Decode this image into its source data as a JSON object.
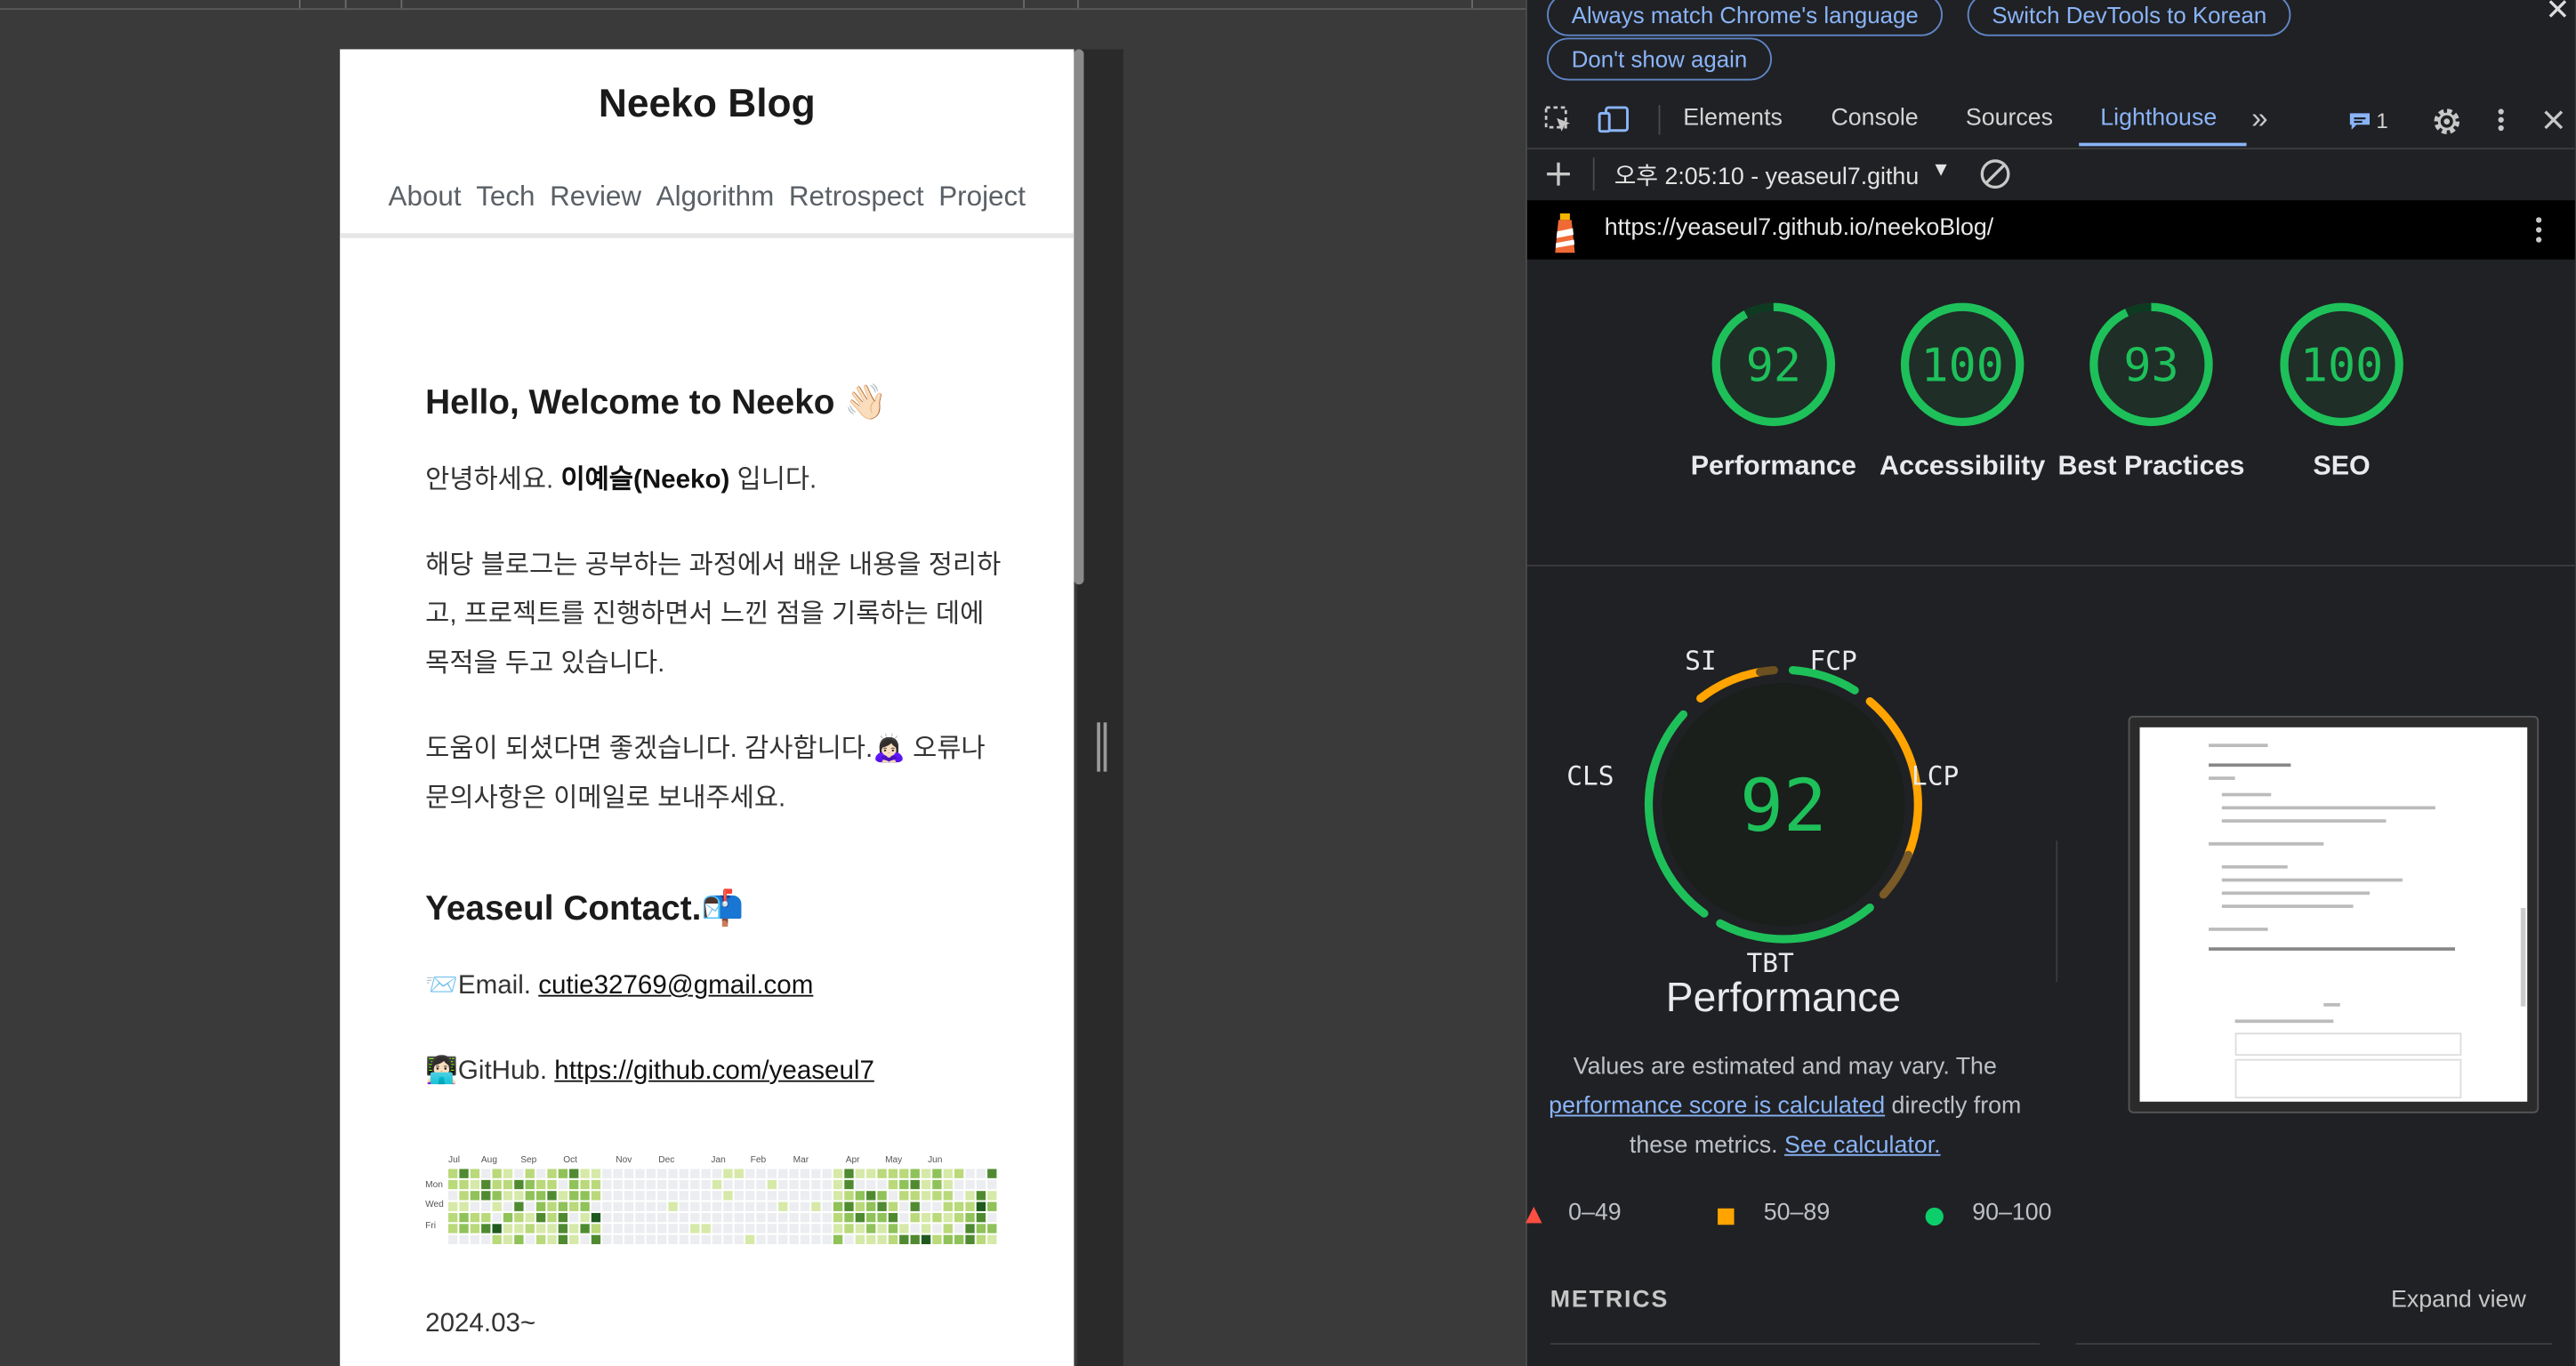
{
  "blog": {
    "title": "Neeko Blog",
    "nav": [
      "About",
      "Tech",
      "Review",
      "Algorithm",
      "Retrospect",
      "Project"
    ],
    "greeting": "Hello, Welcome to Neeko 👋🏻",
    "intro_pre": "안녕하세요. ",
    "intro_name": "이예슬(Neeko)",
    "intro_post": " 입니다.",
    "para2": "해당 블로그는 공부하는 과정에서 배운 내용을 정리하고, 프로젝트를 진행하면서 느낀 점을 기록하는 데에 목적을 두고 있습니다.",
    "para3": "도움이 되셨다면 좋겠습니다. 감사합니다.🙇🏻‍♀️ 오류나 문의사항은 이메일로 보내주세요.",
    "contact_heading": "Yeaseul Contact.📬",
    "email_label": "📨Email. ",
    "email": "cutie32769@gmail.com",
    "github_label": "👩🏻‍💻GitHub. ",
    "github": "https://github.com/yeaseul7",
    "graph_months": [
      "Jul",
      "Aug",
      "Sep",
      "Oct",
      "Nov",
      "Dec",
      "Jan",
      "Feb",
      "Mar",
      "Apr",
      "May",
      "Jun"
    ],
    "graph_days": [
      "Mon",
      "Wed",
      "Fri"
    ],
    "date_line": "2024.03~"
  },
  "devtools": {
    "banner": {
      "match_language": "Always match Chrome's language",
      "switch_korean": "Switch DevTools to Korean",
      "dont_show": "Don't show again"
    },
    "tabs": [
      "Elements",
      "Console",
      "Sources",
      "Lighthouse"
    ],
    "issues_count": "1",
    "report_select": "오후 2:05:10 - yeaseul7.githu",
    "url": "https://yeaseul7.github.io/neekoBlog/",
    "scores": [
      {
        "label": "Performance",
        "value": 92
      },
      {
        "label": "Accessibility",
        "value": 100
      },
      {
        "label": "Best Practices",
        "value": 93
      },
      {
        "label": "SEO",
        "value": 100
      }
    ],
    "perf_gauge": {
      "score": "92",
      "metric_labels": [
        "SI",
        "FCP",
        "LCP",
        "TBT",
        "CLS"
      ],
      "title": "Performance",
      "desc_1": "Values are estimated and may vary. The ",
      "desc_link1": "performance score is calculated",
      "desc_2": " directly from these metrics. ",
      "desc_link2": "See calculator."
    },
    "legend": [
      "0–49",
      "50–89",
      "90–100"
    ],
    "metrics_heading": "METRICS",
    "expand_view": "Expand view",
    "colors": {
      "pass": "#0cce6b",
      "average": "#ffa400",
      "fail": "#ff4e42",
      "link": "#8ab4f8"
    }
  }
}
